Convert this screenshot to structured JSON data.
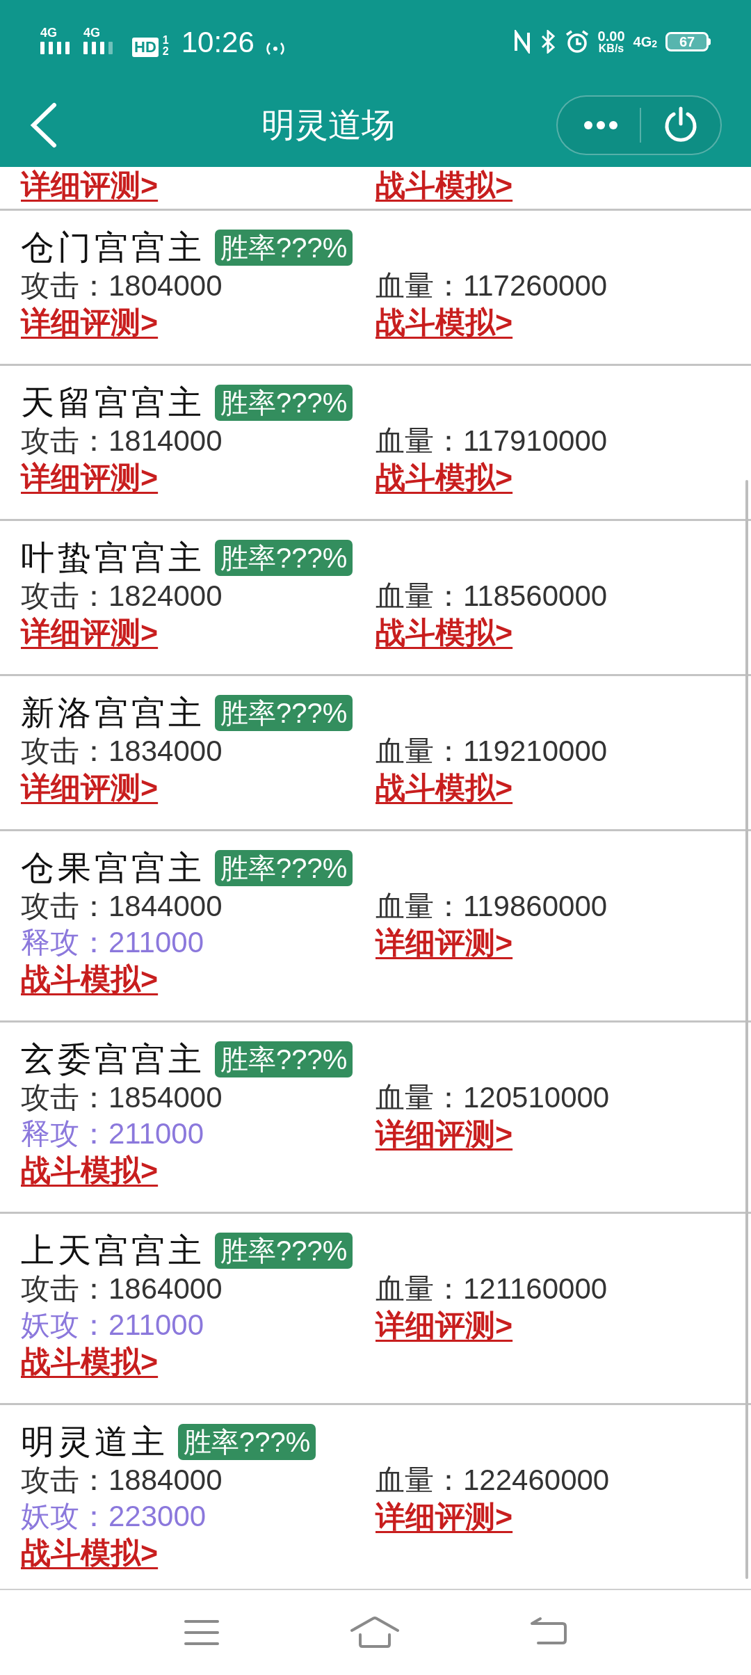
{
  "status_bar": {
    "signal_labels": [
      "4G",
      "4G"
    ],
    "hd": "HD",
    "hd_sub": [
      "1",
      "2"
    ],
    "time": "10:26",
    "speed": "0.00",
    "speed_unit": "KB/s",
    "network_right": "4G",
    "network_right_sub": "2",
    "battery": "67"
  },
  "header": {
    "title": "明灵道场"
  },
  "partial_card": {
    "items": [
      {
        "kind": "link",
        "text": "详细评测>"
      },
      {
        "kind": "link",
        "text": "战斗模拟>"
      }
    ]
  },
  "cards": [
    {
      "name": "仓门宫宫主",
      "badge": "胜率???%",
      "items": [
        {
          "kind": "stat",
          "text": "攻击：1804000"
        },
        {
          "kind": "stat",
          "text": "血量：117260000"
        },
        {
          "kind": "link",
          "text": "详细评测>"
        },
        {
          "kind": "link",
          "text": "战斗模拟>"
        }
      ]
    },
    {
      "name": "天留宫宫主",
      "badge": "胜率???%",
      "items": [
        {
          "kind": "stat",
          "text": "攻击：1814000"
        },
        {
          "kind": "stat",
          "text": "血量：117910000"
        },
        {
          "kind": "link",
          "text": "详细评测>"
        },
        {
          "kind": "link",
          "text": "战斗模拟>"
        }
      ]
    },
    {
      "name": "叶蛰宫宫主",
      "badge": "胜率???%",
      "items": [
        {
          "kind": "stat",
          "text": "攻击：1824000"
        },
        {
          "kind": "stat",
          "text": "血量：118560000"
        },
        {
          "kind": "link",
          "text": "详细评测>"
        },
        {
          "kind": "link",
          "text": "战斗模拟>"
        }
      ]
    },
    {
      "name": "新洛宫宫主",
      "badge": "胜率???%",
      "items": [
        {
          "kind": "stat",
          "text": "攻击：1834000"
        },
        {
          "kind": "stat",
          "text": "血量：119210000"
        },
        {
          "kind": "link",
          "text": "详细评测>"
        },
        {
          "kind": "link",
          "text": "战斗模拟>"
        }
      ]
    },
    {
      "name": "仓果宫宫主",
      "badge": "胜率???%",
      "items": [
        {
          "kind": "stat",
          "text": "攻击：1844000"
        },
        {
          "kind": "stat",
          "text": "血量：119860000"
        },
        {
          "kind": "bonus",
          "text": "释攻：211000"
        },
        {
          "kind": "link",
          "text": "详细评测>"
        },
        {
          "kind": "link",
          "text": "战斗模拟>"
        }
      ]
    },
    {
      "name": "玄委宫宫主",
      "badge": "胜率???%",
      "items": [
        {
          "kind": "stat",
          "text": "攻击：1854000"
        },
        {
          "kind": "stat",
          "text": "血量：120510000"
        },
        {
          "kind": "bonus",
          "text": "释攻：211000"
        },
        {
          "kind": "link",
          "text": "详细评测>"
        },
        {
          "kind": "link",
          "text": "战斗模拟>"
        }
      ]
    },
    {
      "name": "上天宫宫主",
      "badge": "胜率???%",
      "items": [
        {
          "kind": "stat",
          "text": "攻击：1864000"
        },
        {
          "kind": "stat",
          "text": "血量：121160000"
        },
        {
          "kind": "bonus",
          "text": "妖攻：211000"
        },
        {
          "kind": "link",
          "text": "详细评测>"
        },
        {
          "kind": "link",
          "text": "战斗模拟>"
        }
      ]
    },
    {
      "name": "明灵道主",
      "badge": "胜率???%",
      "items": [
        {
          "kind": "stat",
          "text": "攻击：1884000"
        },
        {
          "kind": "stat",
          "text": "血量：122460000"
        },
        {
          "kind": "bonus",
          "text": "妖攻：223000"
        },
        {
          "kind": "link",
          "text": "详细评测>"
        },
        {
          "kind": "link",
          "text": "战斗模拟>"
        }
      ]
    }
  ]
}
